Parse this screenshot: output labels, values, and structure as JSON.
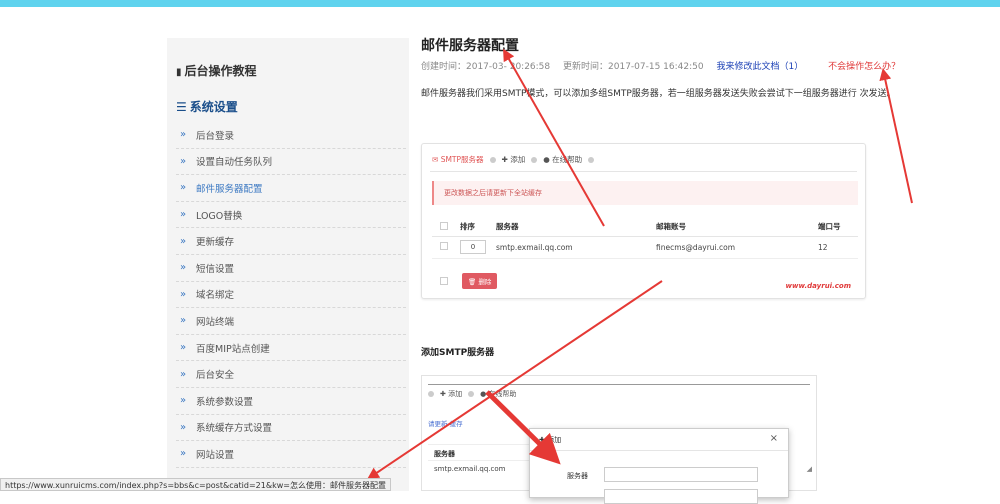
{
  "sidebar": {
    "title": "后台操作教程",
    "section": "系统设置",
    "items": [
      {
        "label": "后台登录"
      },
      {
        "label": "设置自动任务队列"
      },
      {
        "label": "邮件服务器配置"
      },
      {
        "label": "LOGO替换"
      },
      {
        "label": "更新缓存"
      },
      {
        "label": "短信设置"
      },
      {
        "label": "域名绑定"
      },
      {
        "label": "网站终端"
      },
      {
        "label": "百度MIP站点创建"
      },
      {
        "label": "后台安全"
      },
      {
        "label": "系统参数设置"
      },
      {
        "label": "系统缓存方式设置"
      },
      {
        "label": "网站设置"
      }
    ]
  },
  "article": {
    "title": "邮件服务器配置",
    "created": "创建时间：2017-03-  20:26:58",
    "updated": "更新时间：2017-07-15 16:42:50",
    "edit_link": "我来修改此文档（1）",
    "help_link": "不会操作怎么办？",
    "intro": "邮件服务器我们采用SMTP模式，可以添加多组SMTP服务器，若一组服务器发送失败会尝试下一组服务器进行  次发送。",
    "subheading": "添加SMTP服务器"
  },
  "shot1": {
    "tab_active": "SMTP服务器",
    "tab_add": "添加",
    "tab_help": "在线帮助",
    "notice": "更改数据之后请更新下全站缓存",
    "columns": [
      "排序",
      "服务器",
      "邮箱账号",
      "端口号"
    ],
    "row": {
      "order": "0",
      "server": "smtp.exmail.qq.com",
      "account": "finecms@dayrui.com",
      "port": "12"
    },
    "delete_label": "删除",
    "watermark": "www.dayrui.com"
  },
  "shot2": {
    "tab_add": "添加",
    "tab_help": "在线帮助",
    "notice": "请更新   缓存",
    "col_server": "服务器",
    "row_server": "smtp.exmail.qq.com",
    "modal_title": "添加",
    "modal_close": "×",
    "modal_label": "服务器"
  },
  "statusbar": {
    "url": "https://www.xunruicms.com/index.php?s=bbs&c=post&catid=21&kw=怎么使用：邮件服务器配置"
  },
  "colors": {
    "accent": "#5fd3ee",
    "link": "#3b78c2",
    "annotation": "#e53935"
  }
}
